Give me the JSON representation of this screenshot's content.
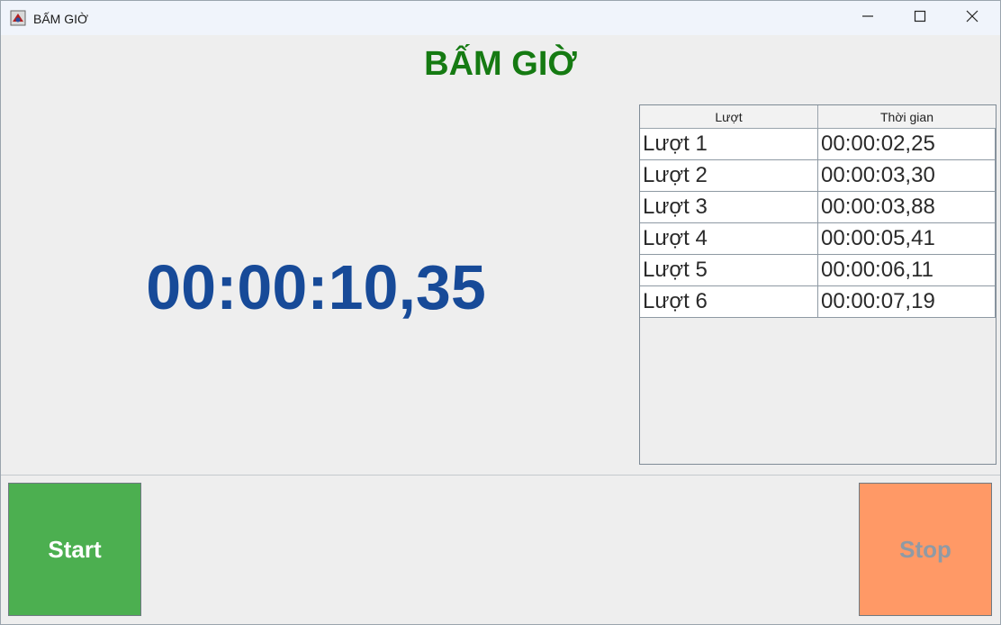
{
  "window": {
    "title": "BẤM GIỜ",
    "app_icon": "java-app-icon",
    "controls": [
      "minimize-icon",
      "maximize-icon",
      "close-icon"
    ]
  },
  "heading": "BẤM GIỜ",
  "timer": "00:00:10,35",
  "laps": {
    "columns": [
      "Lượt",
      "Thời gian"
    ],
    "rows": [
      [
        "Lượt 1",
        "00:00:02,25"
      ],
      [
        "Lượt 2",
        "00:00:03,30"
      ],
      [
        "Lượt 3",
        "00:00:03,88"
      ],
      [
        "Lượt 4",
        "00:00:05,41"
      ],
      [
        "Lượt 5",
        "00:00:06,11"
      ],
      [
        "Lượt 6",
        "00:00:07,19"
      ]
    ]
  },
  "buttons": {
    "start": "Start",
    "stop": "Stop"
  },
  "colors": {
    "heading": "#157a12",
    "timer": "#174a98",
    "start_bg": "#4caf50",
    "stop_bg": "#ff9966"
  }
}
